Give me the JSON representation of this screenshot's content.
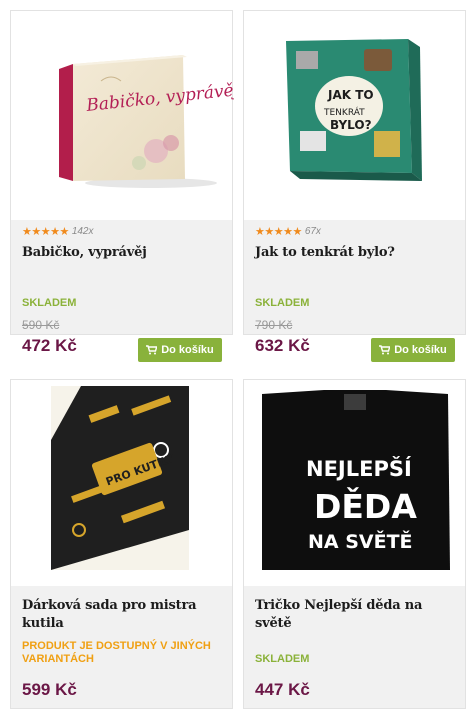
{
  "products": [
    {
      "image_icon": "book-cover-image",
      "cover_text": "Babičko, vyprávěj",
      "stars": "★★★★★",
      "rating_count": "142x",
      "title": "Babičko, vyprávěj",
      "availability": "SKLADEM",
      "old_price": "590 Kč",
      "price": "472 Kč",
      "cart_label": "Do košíku"
    },
    {
      "image_icon": "board-game-box-image",
      "cover_text": "JAK TO TENKRÁT BYLO?",
      "stars": "★★★★★",
      "rating_count": "67x",
      "title": "Jak to tenkrát bylo?",
      "availability": "SKLADEM",
      "old_price": "790 Kč",
      "price": "632 Kč",
      "cart_label": "Do košíku"
    },
    {
      "image_icon": "tool-gift-set-image",
      "cover_text": "PRO KUTILY",
      "title": "Dárková sada pro mistra kutila",
      "availability": "PRODUKT JE DOSTUPNÝ V JINÝCH VARIANTÁCH",
      "price": "599 Kč"
    },
    {
      "image_icon": "black-tshirt-image",
      "cover_text": "NEJLEPŠÍ DĚDA NA SVĚTĚ",
      "title": "Tričko Nejlepší děda na světě",
      "availability": "SKLADEM",
      "price": "447 Kč"
    }
  ],
  "colors": {
    "accent_green": "#89b23b",
    "price": "#6b1746",
    "stock_green": "#8bb23a",
    "variant_orange": "#f0a013",
    "star": "#f08a1c"
  }
}
